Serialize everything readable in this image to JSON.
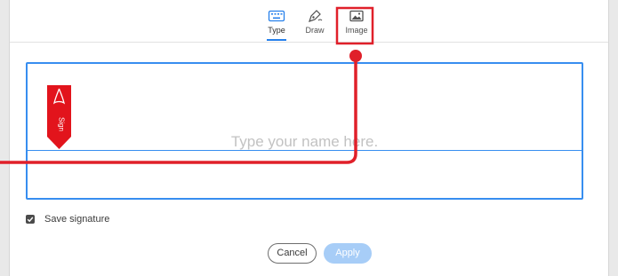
{
  "tabs": [
    {
      "label": "Type",
      "icon": "keyboard-icon",
      "active": true
    },
    {
      "label": "Draw",
      "icon": "pen-nib-icon",
      "active": false
    },
    {
      "label": "Image",
      "icon": "image-icon",
      "active": false
    }
  ],
  "signature": {
    "placeholder": "Type your name here.",
    "sign_badge": "Sign"
  },
  "options": {
    "save_label": "Save signature",
    "save_checked": true
  },
  "buttons": {
    "cancel": "Cancel",
    "apply": "Apply"
  },
  "colors": {
    "accent": "#378ef0",
    "apply_disabled": "#a7cdf7",
    "annotation_red": "#e0202a"
  }
}
